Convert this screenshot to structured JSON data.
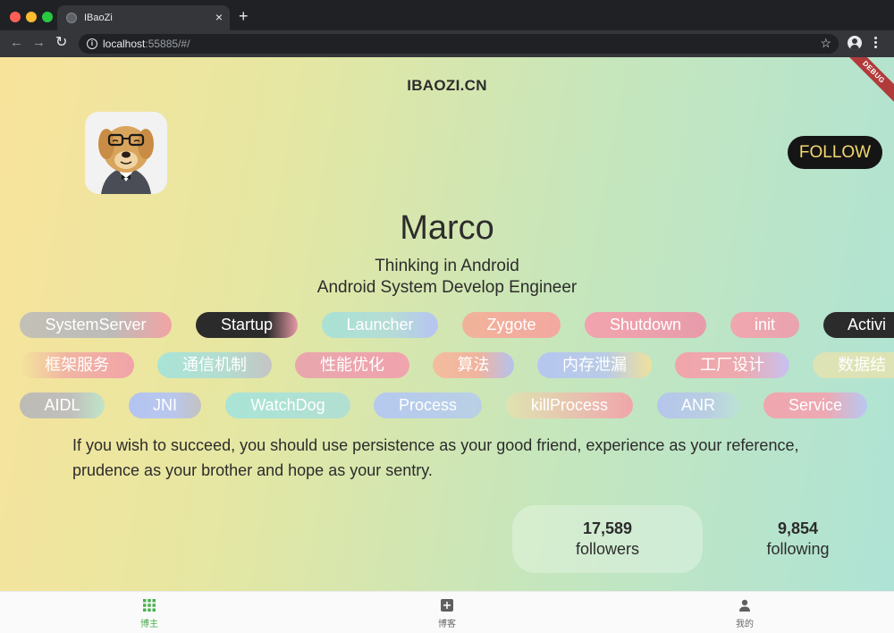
{
  "browser": {
    "tab_title": "IBaoZi",
    "url_host": "localhost",
    "url_rest": ":55885/#/",
    "debug_label": "DEBUG"
  },
  "header": {
    "site_title": "IBAOZI.CN"
  },
  "profile": {
    "follow_label": "FOLLOW",
    "name": "Marco",
    "bio_line1": "Thinking in Android",
    "bio_line2": "Android System Develop Engineer",
    "quote": "If you wish to succeed, you should use persistence as your good friend, experience as your reference, prudence as your brother and hope as your sentry."
  },
  "tags": {
    "row1": [
      "SystemServer",
      "Startup",
      "Launcher",
      "Zygote",
      "Shutdown",
      "init",
      "Activi"
    ],
    "row2": [
      "框架服务",
      "通信机制",
      "性能优化",
      "算法",
      "内存泄漏",
      "工厂设计",
      "数据结"
    ],
    "row3": [
      "AIDL",
      "JNI",
      "WatchDog",
      "Process",
      "killProcess",
      "ANR",
      "Service"
    ]
  },
  "stats": {
    "followers_count": "17,589",
    "followers_label": "followers",
    "following_count": "9,854",
    "following_label": "following"
  },
  "bottom_nav": {
    "item1": "博主",
    "item2": "博客",
    "item3": "我的"
  },
  "colors": {
    "active_nav": "#4caf50",
    "follow_text": "#f4d770"
  }
}
